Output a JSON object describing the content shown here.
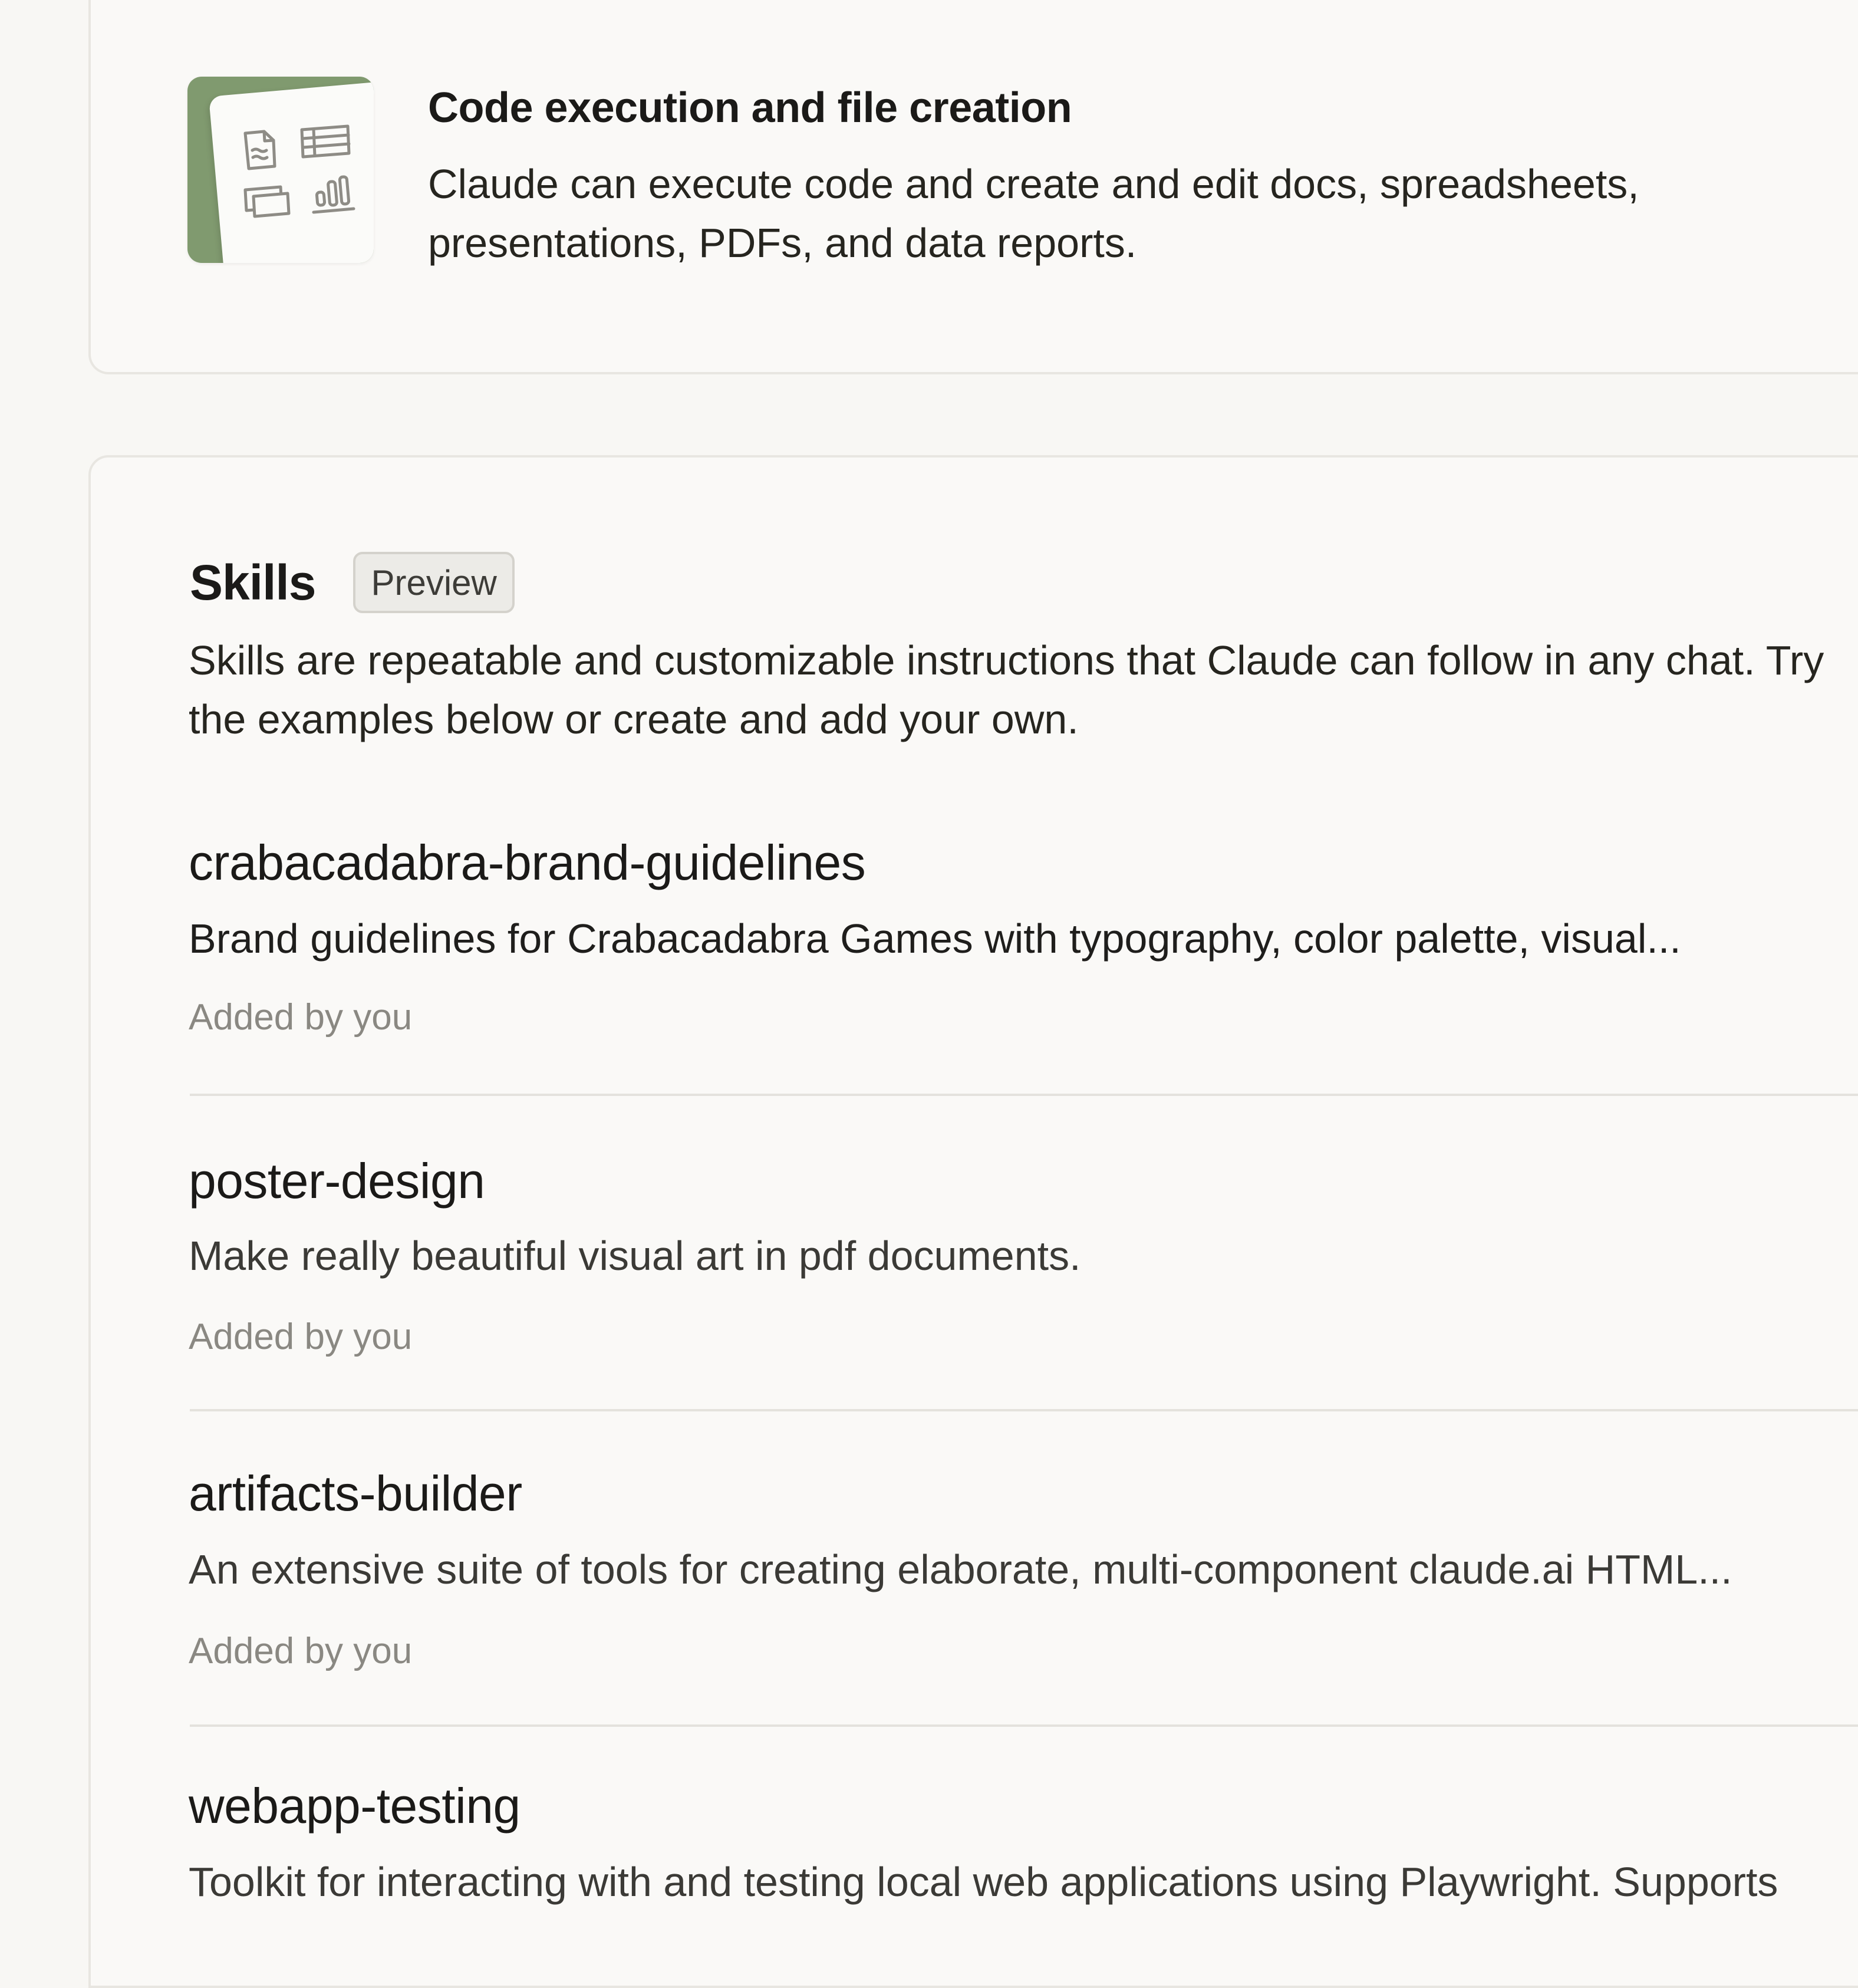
{
  "feature": {
    "title": "Code execution and file creation",
    "description": "Claude can execute code and create and edit docs, spreadsheets, presentations, PDFs, and data reports.",
    "thumbnail_icons": [
      "document-icon",
      "table-icon",
      "slides-icon",
      "bar-chart-icon"
    ],
    "thumbnail_color": "#809a6f"
  },
  "skills": {
    "title": "Skills",
    "badge": "Preview",
    "description": "Skills are repeatable and customizable instructions that Claude can follow in any chat. Try the examples below or create and add your own.",
    "items": [
      {
        "name": "crabacadabra-brand-guidelines",
        "description": "Brand guidelines for Crabacadabra Games with typography, color palette, visual...",
        "meta": "Added by you"
      },
      {
        "name": "poster-design",
        "description": "Make really beautiful visual art in pdf documents.",
        "meta": "Added by you"
      },
      {
        "name": "artifacts-builder",
        "description": "An extensive suite of tools for creating elaborate, multi-component claude.ai HTML...",
        "meta": "Added by you"
      },
      {
        "name": "webapp-testing",
        "description": "Toolkit for interacting with and testing local web applications using Playwright. Supports",
        "meta": ""
      }
    ]
  }
}
